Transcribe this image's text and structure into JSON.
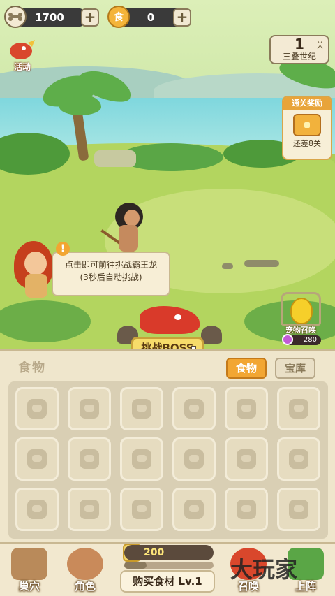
{
  "resources": {
    "bones": {
      "value": "1700",
      "icon": "bone-icon"
    },
    "coins": {
      "value": "0",
      "icon": "gold-coin-icon",
      "icon_text": "食"
    }
  },
  "event": {
    "label": "活动"
  },
  "stage": {
    "number": "1",
    "unit": "关",
    "era": "三叠世纪"
  },
  "clear_reward": {
    "title": "通关奖励",
    "remaining": "还差8关"
  },
  "dialog": {
    "alert": "!",
    "line1": "点击即可前往挑战霸王龙",
    "line2": "(3秒后自动挑战)"
  },
  "pet_summon": {
    "label": "宠物召唤",
    "cost": "280"
  },
  "boss_button": {
    "label": "挑战BOSS"
  },
  "panel": {
    "title": "食物",
    "tabs": [
      {
        "label": "食物",
        "active": true
      },
      {
        "label": "宝库",
        "active": false
      }
    ],
    "slot_count": 18
  },
  "bottom_nav": {
    "left": [
      {
        "label": "巢穴"
      },
      {
        "label": "角色"
      }
    ],
    "right": [
      {
        "label": "召唤"
      },
      {
        "label": "上阵"
      }
    ],
    "food_amount": "200",
    "buy_label": "购买食材 Lv.1",
    "progress": 0.25
  },
  "watermark": "大玩家",
  "colors": {
    "accent": "#f2a632",
    "panel": "#efe6cc",
    "boss": "#f7dc6a"
  }
}
